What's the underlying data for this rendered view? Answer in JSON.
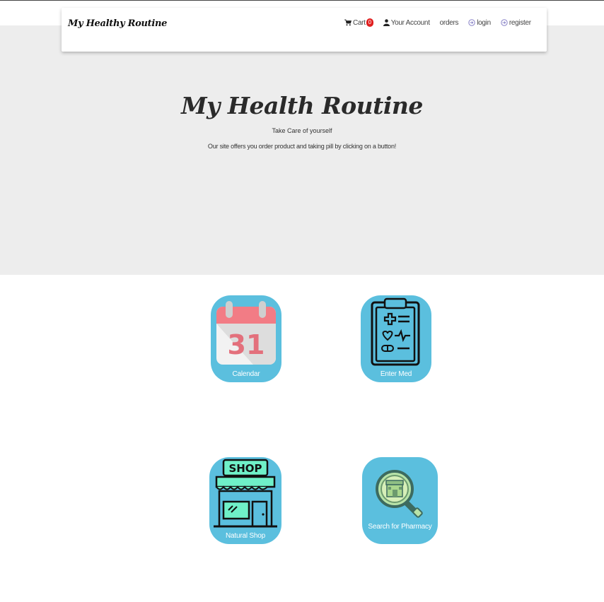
{
  "brand": "My Healthy Routine",
  "nav": {
    "cart_label": "Cart",
    "cart_count": "0",
    "account_label": "Your Account",
    "orders_label": "orders",
    "login_label": "login",
    "register_label": "register"
  },
  "hero": {
    "title": "My Health Routine",
    "tagline": "Take Care of yourself",
    "description": "Our site offers you order product and taking pill by clicking on a button!"
  },
  "tiles": [
    {
      "label": "Calendar",
      "icon": "calendar-icon",
      "calendar_day": "31"
    },
    {
      "label": "Enter Med",
      "icon": "clipboard-medical-icon"
    },
    {
      "label": "Natural Shop",
      "icon": "shop-icon",
      "sign_text": "SHOP"
    },
    {
      "label": "Search for Pharmacy",
      "icon": "pharmacy-search-icon"
    }
  ],
  "colors": {
    "hero_background": "#ededed",
    "tile_background": "#5bbfde",
    "badge": "#e01e1e"
  }
}
